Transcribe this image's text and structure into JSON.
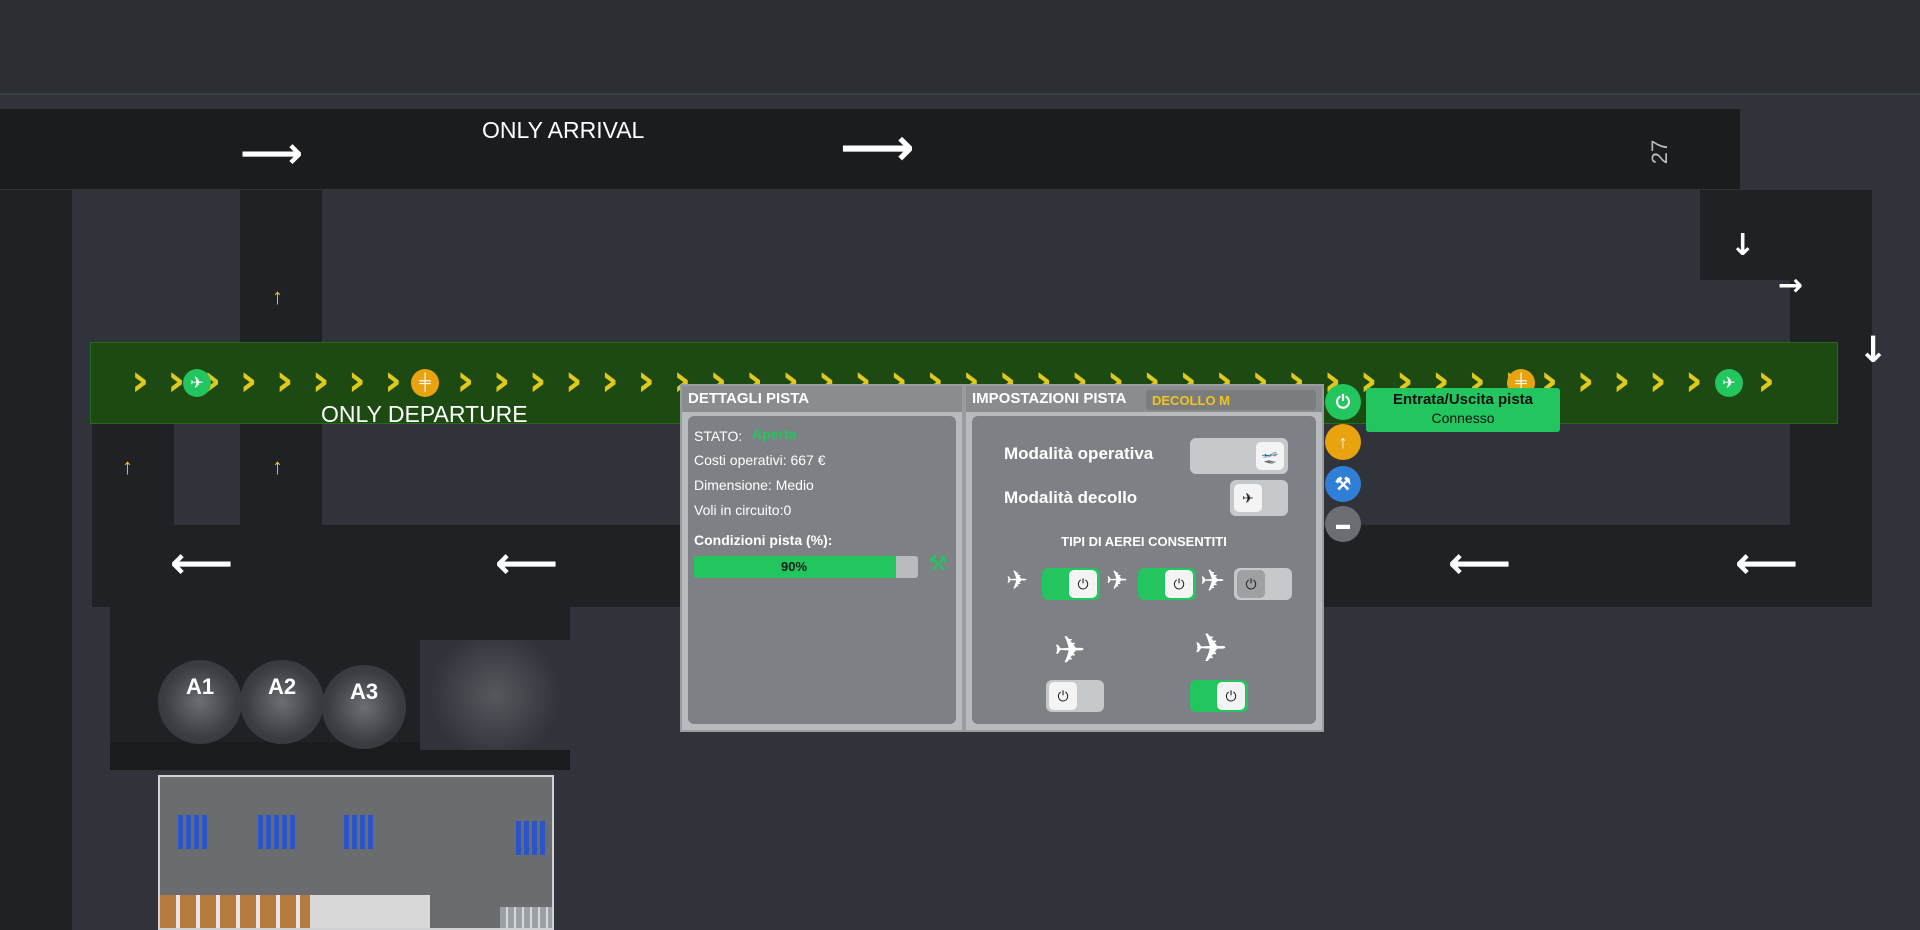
{
  "map": {
    "label_arrival": "ONLY ARRIVAL",
    "label_departure": "ONLY DEPARTURE",
    "stands": [
      "A1",
      "A2",
      "A3"
    ],
    "runway_number_right": "27"
  },
  "details": {
    "title": "DETTAGLI PISTA",
    "status_label": "STATO:",
    "status_value": "Aperta",
    "cost": "Costi operativi: 667 €",
    "size": "Dimensione: Medio",
    "flights": "Voli in circuito:0",
    "condition_label": "Condizioni pista (%):",
    "condition_value": "90%",
    "condition_fraction": 0.9
  },
  "settings": {
    "title": "IMPOSTAZIONI PISTA",
    "tag": "DECOLLO M",
    "mode_label": "Modalità operativa",
    "takeoff_label": "Modalità decollo",
    "types_title": "TIPI DI AEREI CONSENTITI",
    "types": [
      {
        "name": "propeller",
        "enabled": true
      },
      {
        "name": "jet-small",
        "enabled": true
      },
      {
        "name": "jet-large",
        "enabled": false
      },
      {
        "name": "turboprop",
        "enabled": false
      },
      {
        "name": "airliner",
        "enabled": true
      }
    ]
  },
  "entry": {
    "title": "Entrata/Uscita pista",
    "status": "Connesso"
  },
  "colors": {
    "accent_green": "#22c55e",
    "tag_yellow": "#f2c318",
    "runway_green": "#1c4a12",
    "button_blue": "#2f7fd6",
    "button_orange": "#e8a30e"
  }
}
